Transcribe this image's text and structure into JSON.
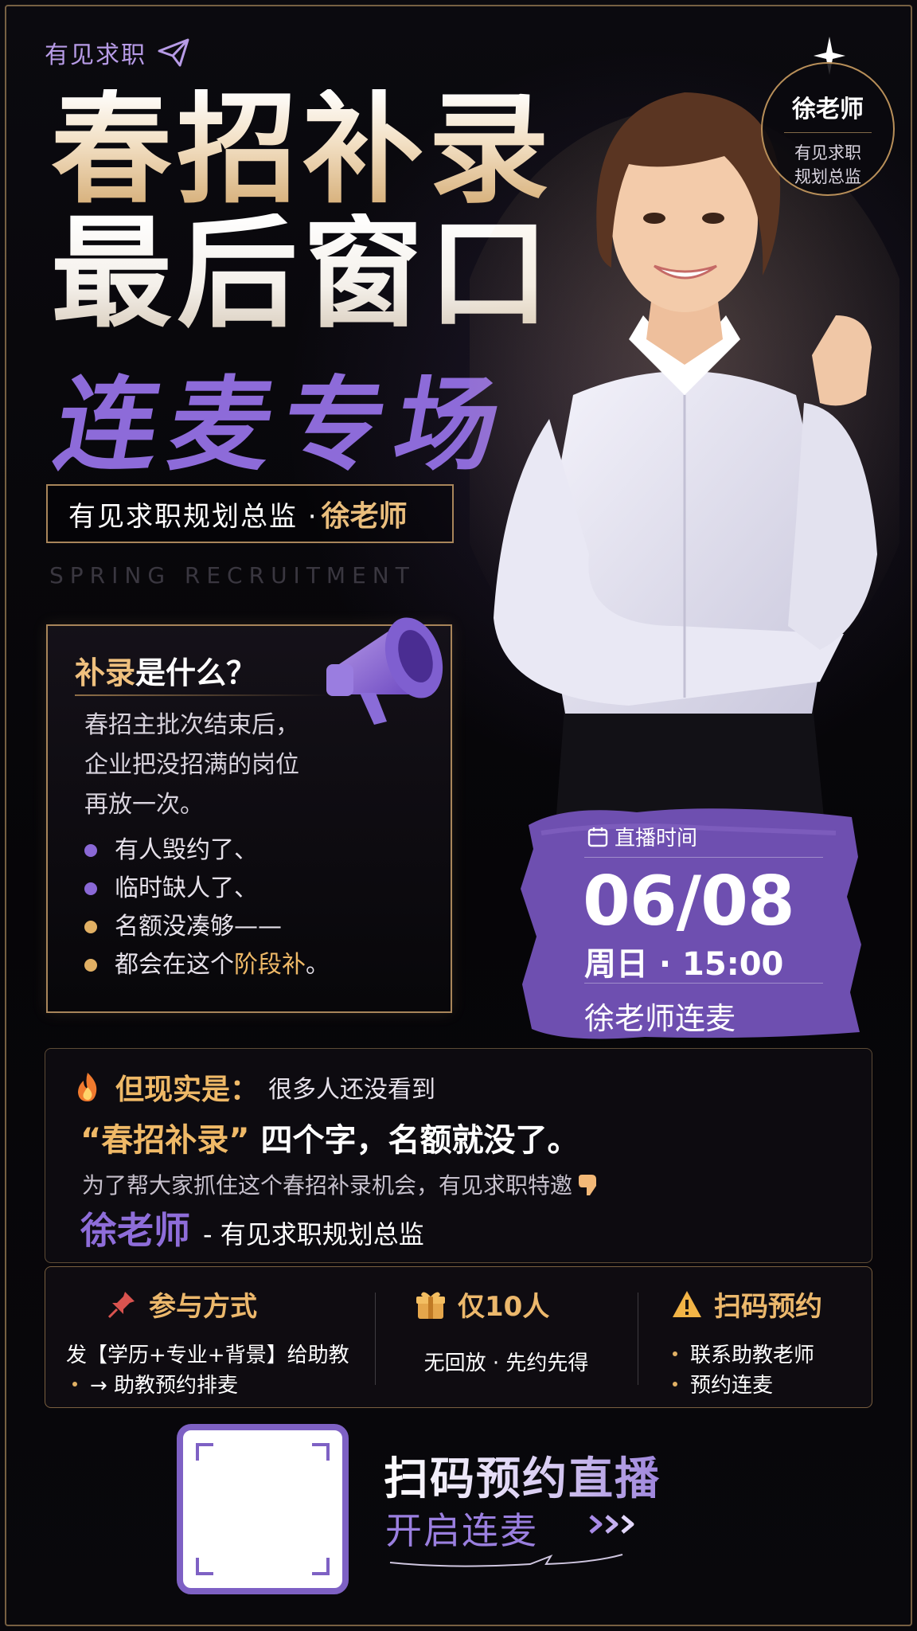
{
  "brand": {
    "name": "有见求职",
    "icon": "paper-plane-icon"
  },
  "headline": {
    "line1": "春招补录",
    "line2": "最后窗口",
    "line3": "连麦专场"
  },
  "subtitle": {
    "prefix": "有见求职规划总监 ·",
    "name": "徐老师"
  },
  "english_tag": "SPRING RECRUITMENT",
  "badge": {
    "name": "徐老师",
    "line1": "有见求职",
    "line2": "规划总监"
  },
  "what": {
    "title_highlight": "补录",
    "title_rest": "是什么？",
    "desc": [
      "春招主批次结束后，",
      "企业把没招满的岗位",
      "再放一次。"
    ],
    "items": [
      {
        "text": "有人毁约了、",
        "dot": "purple"
      },
      {
        "text": "临时缺人了、",
        "dot": "purple"
      },
      {
        "text": "名额没凑够——",
        "dot": "gold"
      },
      {
        "text": "都会在这个",
        "highlight": "阶段补",
        "tail": "。",
        "dot": "gold"
      }
    ]
  },
  "live": {
    "label": "直播时间",
    "date": "06/08",
    "time": "周日 · 15:00",
    "host": "徐老师连麦"
  },
  "reality": {
    "key": "但现实是：",
    "line1_rest": "很多人还没看到",
    "quote": "“春招补录”",
    "line2_rest": "四个字，名额就没了。",
    "line3": "为了帮大家抓住这个春招补录机会，有见求职特邀",
    "name": "徐老师",
    "title": "- 有见求职规划总监"
  },
  "info": {
    "col1": {
      "title": "参与方式",
      "line1": "发【学历+专业+背景】给助教",
      "line2": "→ 助教预约排麦"
    },
    "col2": {
      "title": "仅10人",
      "line1": "无回放 · 先约先得"
    },
    "col3": {
      "title": "扫码预约",
      "item1": "联系助教老师",
      "item2": "预约连麦"
    }
  },
  "cta": {
    "main": "扫码预约直播",
    "sub": "开启连麦"
  },
  "colors": {
    "gold": "#efb967",
    "purple": "#8e6dd9",
    "background": "#08070b"
  }
}
